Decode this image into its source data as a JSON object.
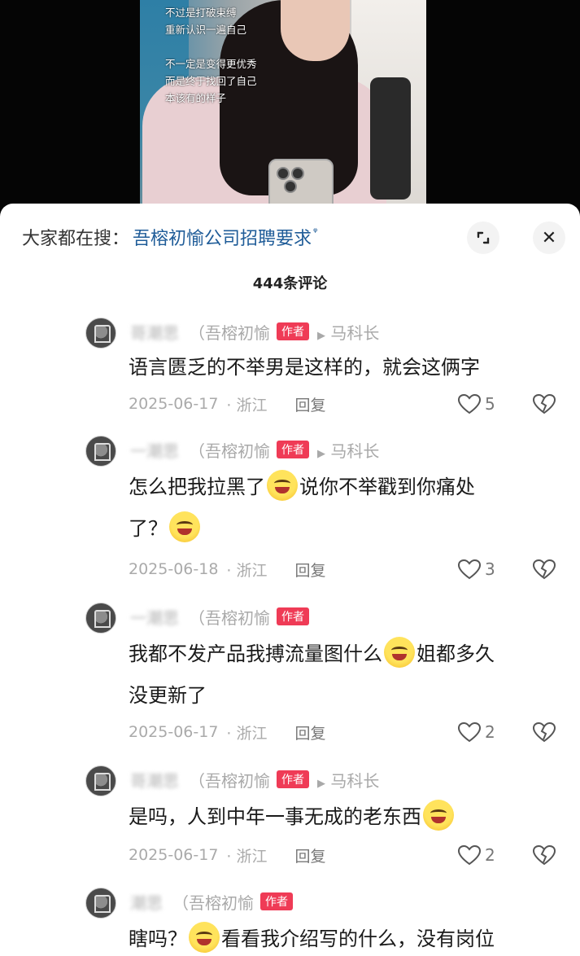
{
  "video": {
    "captions": [
      "不过是打破束缚",
      "重新认识一遍自己",
      "不一定是变得更优秀",
      "而是终于找回了自己",
      "本该有的样子"
    ]
  },
  "search_bar": {
    "prefix": "大家都在搜：",
    "term": "吾榕初愉公司招聘要求",
    "glass": "ᵠ"
  },
  "header": {
    "comment_count": "444条评论",
    "close_icon": "✕"
  },
  "comments": [
    {
      "username": "哥潮思",
      "tag": "（吾榕初愉",
      "badge": "作者",
      "reply_to": "马科长",
      "text_1": "语言匮乏的不举男是这样的，就会这俩字",
      "text_2": "",
      "date": "2025-06-17",
      "location": "浙江",
      "reply": "回复",
      "likes": "5"
    },
    {
      "username": "一潮思",
      "tag": "（吾榕初愉",
      "badge": "作者",
      "reply_to": "马科长",
      "text_1": "怎么把我拉黑了",
      "text_2": "说你不举戳到你痛处",
      "text_3": "了？",
      "date": "2025-06-18",
      "location": "浙江",
      "reply": "回复",
      "likes": "3"
    },
    {
      "username": "一潮思",
      "tag": "（吾榕初愉",
      "badge": "作者",
      "text_1": "我都不发产品我搏流量图什么",
      "text_2": "姐都多久",
      "text_3": "没更新了",
      "date": "2025-06-17",
      "location": "浙江",
      "reply": "回复",
      "likes": "2"
    },
    {
      "username": "哥潮思",
      "tag": "（吾榕初愉",
      "badge": "作者",
      "reply_to": "马科长",
      "text_1": "是吗，人到中年一事无成的老东西",
      "date": "2025-06-17",
      "location": "浙江",
      "reply": "回复",
      "likes": "2"
    },
    {
      "username": "潮思",
      "tag": "（吾榕初愉",
      "badge": "作者",
      "text_1": "瞎吗？",
      "text_2": "看看我介绍写的什么，没有岗位"
    }
  ]
}
